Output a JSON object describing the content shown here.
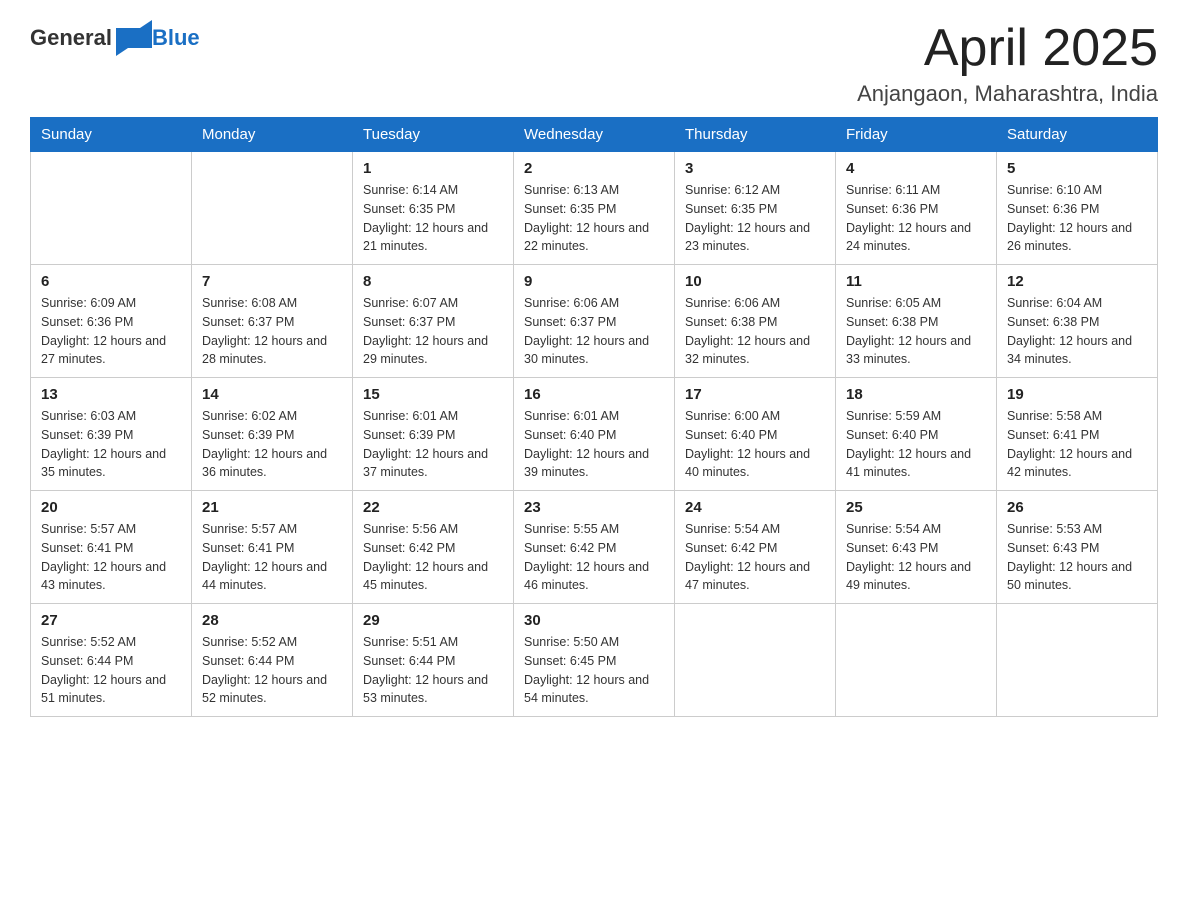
{
  "header": {
    "logo_general": "General",
    "logo_blue": "Blue",
    "month_title": "April 2025",
    "location": "Anjangaon, Maharashtra, India"
  },
  "days_of_week": [
    "Sunday",
    "Monday",
    "Tuesday",
    "Wednesday",
    "Thursday",
    "Friday",
    "Saturday"
  ],
  "weeks": [
    [
      {
        "day": "",
        "sunrise": "",
        "sunset": "",
        "daylight": ""
      },
      {
        "day": "",
        "sunrise": "",
        "sunset": "",
        "daylight": ""
      },
      {
        "day": "1",
        "sunrise": "Sunrise: 6:14 AM",
        "sunset": "Sunset: 6:35 PM",
        "daylight": "Daylight: 12 hours and 21 minutes."
      },
      {
        "day": "2",
        "sunrise": "Sunrise: 6:13 AM",
        "sunset": "Sunset: 6:35 PM",
        "daylight": "Daylight: 12 hours and 22 minutes."
      },
      {
        "day": "3",
        "sunrise": "Sunrise: 6:12 AM",
        "sunset": "Sunset: 6:35 PM",
        "daylight": "Daylight: 12 hours and 23 minutes."
      },
      {
        "day": "4",
        "sunrise": "Sunrise: 6:11 AM",
        "sunset": "Sunset: 6:36 PM",
        "daylight": "Daylight: 12 hours and 24 minutes."
      },
      {
        "day": "5",
        "sunrise": "Sunrise: 6:10 AM",
        "sunset": "Sunset: 6:36 PM",
        "daylight": "Daylight: 12 hours and 26 minutes."
      }
    ],
    [
      {
        "day": "6",
        "sunrise": "Sunrise: 6:09 AM",
        "sunset": "Sunset: 6:36 PM",
        "daylight": "Daylight: 12 hours and 27 minutes."
      },
      {
        "day": "7",
        "sunrise": "Sunrise: 6:08 AM",
        "sunset": "Sunset: 6:37 PM",
        "daylight": "Daylight: 12 hours and 28 minutes."
      },
      {
        "day": "8",
        "sunrise": "Sunrise: 6:07 AM",
        "sunset": "Sunset: 6:37 PM",
        "daylight": "Daylight: 12 hours and 29 minutes."
      },
      {
        "day": "9",
        "sunrise": "Sunrise: 6:06 AM",
        "sunset": "Sunset: 6:37 PM",
        "daylight": "Daylight: 12 hours and 30 minutes."
      },
      {
        "day": "10",
        "sunrise": "Sunrise: 6:06 AM",
        "sunset": "Sunset: 6:38 PM",
        "daylight": "Daylight: 12 hours and 32 minutes."
      },
      {
        "day": "11",
        "sunrise": "Sunrise: 6:05 AM",
        "sunset": "Sunset: 6:38 PM",
        "daylight": "Daylight: 12 hours and 33 minutes."
      },
      {
        "day": "12",
        "sunrise": "Sunrise: 6:04 AM",
        "sunset": "Sunset: 6:38 PM",
        "daylight": "Daylight: 12 hours and 34 minutes."
      }
    ],
    [
      {
        "day": "13",
        "sunrise": "Sunrise: 6:03 AM",
        "sunset": "Sunset: 6:39 PM",
        "daylight": "Daylight: 12 hours and 35 minutes."
      },
      {
        "day": "14",
        "sunrise": "Sunrise: 6:02 AM",
        "sunset": "Sunset: 6:39 PM",
        "daylight": "Daylight: 12 hours and 36 minutes."
      },
      {
        "day": "15",
        "sunrise": "Sunrise: 6:01 AM",
        "sunset": "Sunset: 6:39 PM",
        "daylight": "Daylight: 12 hours and 37 minutes."
      },
      {
        "day": "16",
        "sunrise": "Sunrise: 6:01 AM",
        "sunset": "Sunset: 6:40 PM",
        "daylight": "Daylight: 12 hours and 39 minutes."
      },
      {
        "day": "17",
        "sunrise": "Sunrise: 6:00 AM",
        "sunset": "Sunset: 6:40 PM",
        "daylight": "Daylight: 12 hours and 40 minutes."
      },
      {
        "day": "18",
        "sunrise": "Sunrise: 5:59 AM",
        "sunset": "Sunset: 6:40 PM",
        "daylight": "Daylight: 12 hours and 41 minutes."
      },
      {
        "day": "19",
        "sunrise": "Sunrise: 5:58 AM",
        "sunset": "Sunset: 6:41 PM",
        "daylight": "Daylight: 12 hours and 42 minutes."
      }
    ],
    [
      {
        "day": "20",
        "sunrise": "Sunrise: 5:57 AM",
        "sunset": "Sunset: 6:41 PM",
        "daylight": "Daylight: 12 hours and 43 minutes."
      },
      {
        "day": "21",
        "sunrise": "Sunrise: 5:57 AM",
        "sunset": "Sunset: 6:41 PM",
        "daylight": "Daylight: 12 hours and 44 minutes."
      },
      {
        "day": "22",
        "sunrise": "Sunrise: 5:56 AM",
        "sunset": "Sunset: 6:42 PM",
        "daylight": "Daylight: 12 hours and 45 minutes."
      },
      {
        "day": "23",
        "sunrise": "Sunrise: 5:55 AM",
        "sunset": "Sunset: 6:42 PM",
        "daylight": "Daylight: 12 hours and 46 minutes."
      },
      {
        "day": "24",
        "sunrise": "Sunrise: 5:54 AM",
        "sunset": "Sunset: 6:42 PM",
        "daylight": "Daylight: 12 hours and 47 minutes."
      },
      {
        "day": "25",
        "sunrise": "Sunrise: 5:54 AM",
        "sunset": "Sunset: 6:43 PM",
        "daylight": "Daylight: 12 hours and 49 minutes."
      },
      {
        "day": "26",
        "sunrise": "Sunrise: 5:53 AM",
        "sunset": "Sunset: 6:43 PM",
        "daylight": "Daylight: 12 hours and 50 minutes."
      }
    ],
    [
      {
        "day": "27",
        "sunrise": "Sunrise: 5:52 AM",
        "sunset": "Sunset: 6:44 PM",
        "daylight": "Daylight: 12 hours and 51 minutes."
      },
      {
        "day": "28",
        "sunrise": "Sunrise: 5:52 AM",
        "sunset": "Sunset: 6:44 PM",
        "daylight": "Daylight: 12 hours and 52 minutes."
      },
      {
        "day": "29",
        "sunrise": "Sunrise: 5:51 AM",
        "sunset": "Sunset: 6:44 PM",
        "daylight": "Daylight: 12 hours and 53 minutes."
      },
      {
        "day": "30",
        "sunrise": "Sunrise: 5:50 AM",
        "sunset": "Sunset: 6:45 PM",
        "daylight": "Daylight: 12 hours and 54 minutes."
      },
      {
        "day": "",
        "sunrise": "",
        "sunset": "",
        "daylight": ""
      },
      {
        "day": "",
        "sunrise": "",
        "sunset": "",
        "daylight": ""
      },
      {
        "day": "",
        "sunrise": "",
        "sunset": "",
        "daylight": ""
      }
    ]
  ]
}
